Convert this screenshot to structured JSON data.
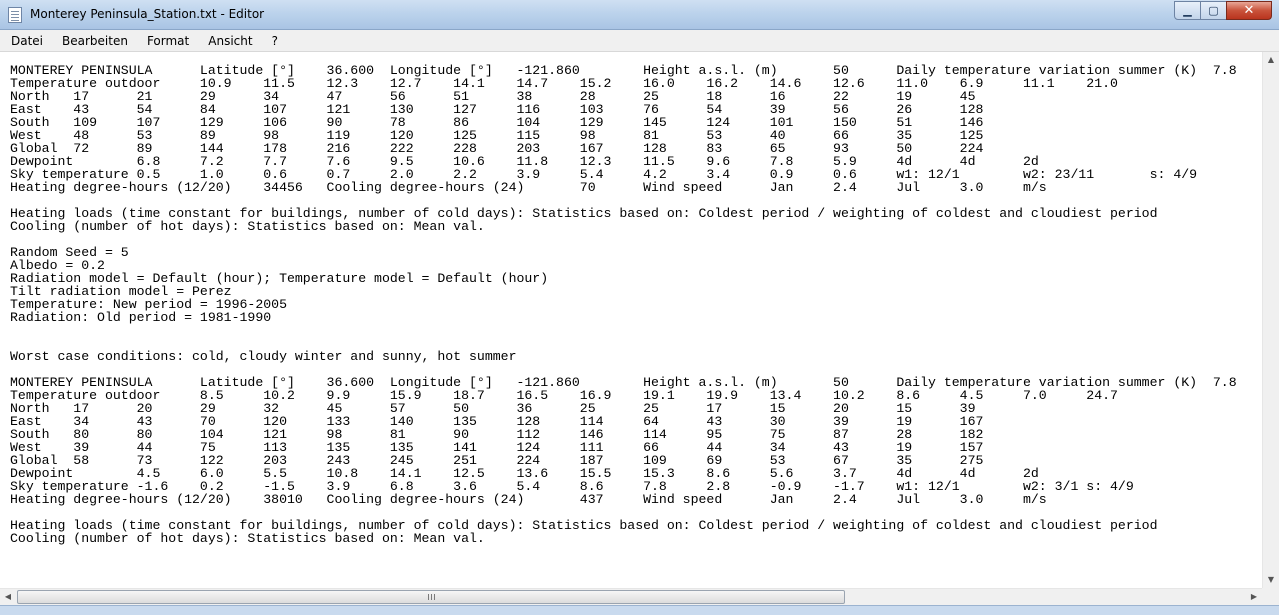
{
  "window": {
    "title": "Monterey Peninsula_Station.txt - Editor",
    "minimize_glyph": "▁",
    "maximize_glyph": "▢",
    "close_glyph": "✕"
  },
  "menu": {
    "items": [
      "Datei",
      "Bearbeiten",
      "Format",
      "Ansicht",
      "?"
    ]
  },
  "editor": {
    "content": "MONTEREY PENINSULA      Latitude [°]    36.600  Longitude [°]   -121.860        Height a.s.l. (m)       50      Daily temperature variation summer (K)  7.8\nTemperature outdoor     10.9    11.5    12.3    12.7    14.1    14.7    15.2    16.0    16.2    14.6    12.6    11.0    6.9     11.1    21.0\nNorth   17      21      29      34      47      56      51      38      28      25      18      16      22      19      45\nEast    43      54      84      107     121     130     127     116     103     76      54      39      56      26      128\nSouth   109     107     129     106     90      78      86      104     129     145     124     101     150     51      146\nWest    48      53      89      98      119     120     125     115     98      81      53      40      66      35      125\nGlobal  72      89      144     178     216     222     228     203     167     128     83      65      93      50      224\nDewpoint        6.8     7.2     7.7     7.6     9.5     10.6    11.8    12.3    11.5    9.6     7.8     5.9     4d      4d      2d\nSky temperature 0.5     1.0     0.6     0.7     2.0     2.2     3.9     5.4     4.2     3.4     0.9     0.6     w1: 12/1        w2: 23/11       s: 4/9\nHeating degree-hours (12/20)    34456   Cooling degree-hours (24)       70      Wind speed      Jan     2.4     Jul     3.0     m/s\n\nHeating loads (time constant for buildings, number of cold days): Statistics based on: Coldest period / weighting of coldest and cloudiest period\nCooling (number of hot days): Statistics based on: Mean val.\n\nRandom Seed = 5\nAlbedo = 0.2\nRadiation model = Default (hour); Temperature model = Default (hour)\nTilt radiation model = Perez\nTemperature: New period = 1996-2005\nRadiation: Old period = 1981-1990\n\n\nWorst case conditions: cold, cloudy winter and sunny, hot summer\n\nMONTEREY PENINSULA      Latitude [°]    36.600  Longitude [°]   -121.860        Height a.s.l. (m)       50      Daily temperature variation summer (K)  7.8\nTemperature outdoor     8.5     10.2    9.9     15.9    18.7    16.5    16.9    19.1    19.9    13.4    10.2    8.6     4.5     7.0     24.7\nNorth   17      20      29      32      45      57      50      36      25      25      17      15      20      15      39\nEast    34      43      70      120     133     140     135     128     114     64      43      30      39      19      167\nSouth   80      80      104     121     98      81      90      112     146     114     95      75      87      28      182\nWest    39      44      75      113     135     135     141     124     111     66      44      34      43      19      157\nGlobal  58      73      122     203     243     245     251     224     187     109     69      53      67      35      275\nDewpoint        4.5     6.0     5.5     10.8    14.1    12.5    13.6    15.5    15.3    8.6     5.6     3.7     4d      4d      2d\nSky temperature -1.6    0.2     -1.5    3.9     6.8     3.6     5.4     8.6     7.8     2.8     -0.9    -1.7    w1: 12/1        w2: 3/1 s: 4/9\nHeating degree-hours (12/20)    38010   Cooling degree-hours (24)       437     Wind speed      Jan     2.4     Jul     3.0     m/s\n\nHeating loads (time constant for buildings, number of cold days): Statistics based on: Coldest period / weighting of coldest and cloudiest period\nCooling (number of hot days): Statistics based on: Mean val."
  },
  "scrollbars": {
    "up_glyph": "▲",
    "down_glyph": "▼",
    "left_glyph": "◀",
    "right_glyph": "▶"
  }
}
